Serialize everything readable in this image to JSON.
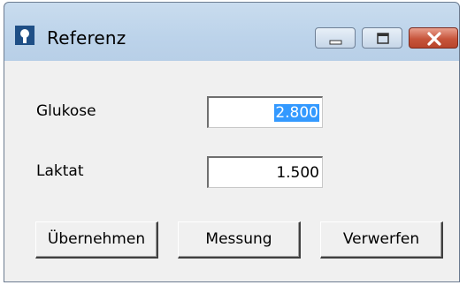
{
  "window": {
    "title": "Referenz"
  },
  "form": {
    "glukose_label": "Glukose",
    "glukose_value": "2.800",
    "laktat_label": "Laktat",
    "laktat_value": "1.500"
  },
  "buttons": {
    "uebernehmen": "Übernehmen",
    "messung": "Messung",
    "verwerfen": "Verwerfen"
  },
  "colors": {
    "selection": "#3399ff",
    "close_button": "#c7553c",
    "titlebar": "#bcd3ea"
  },
  "icons": {
    "app": "app-icon",
    "minimize": "minimize-icon",
    "maximize": "maximize-icon",
    "close": "close-icon"
  }
}
